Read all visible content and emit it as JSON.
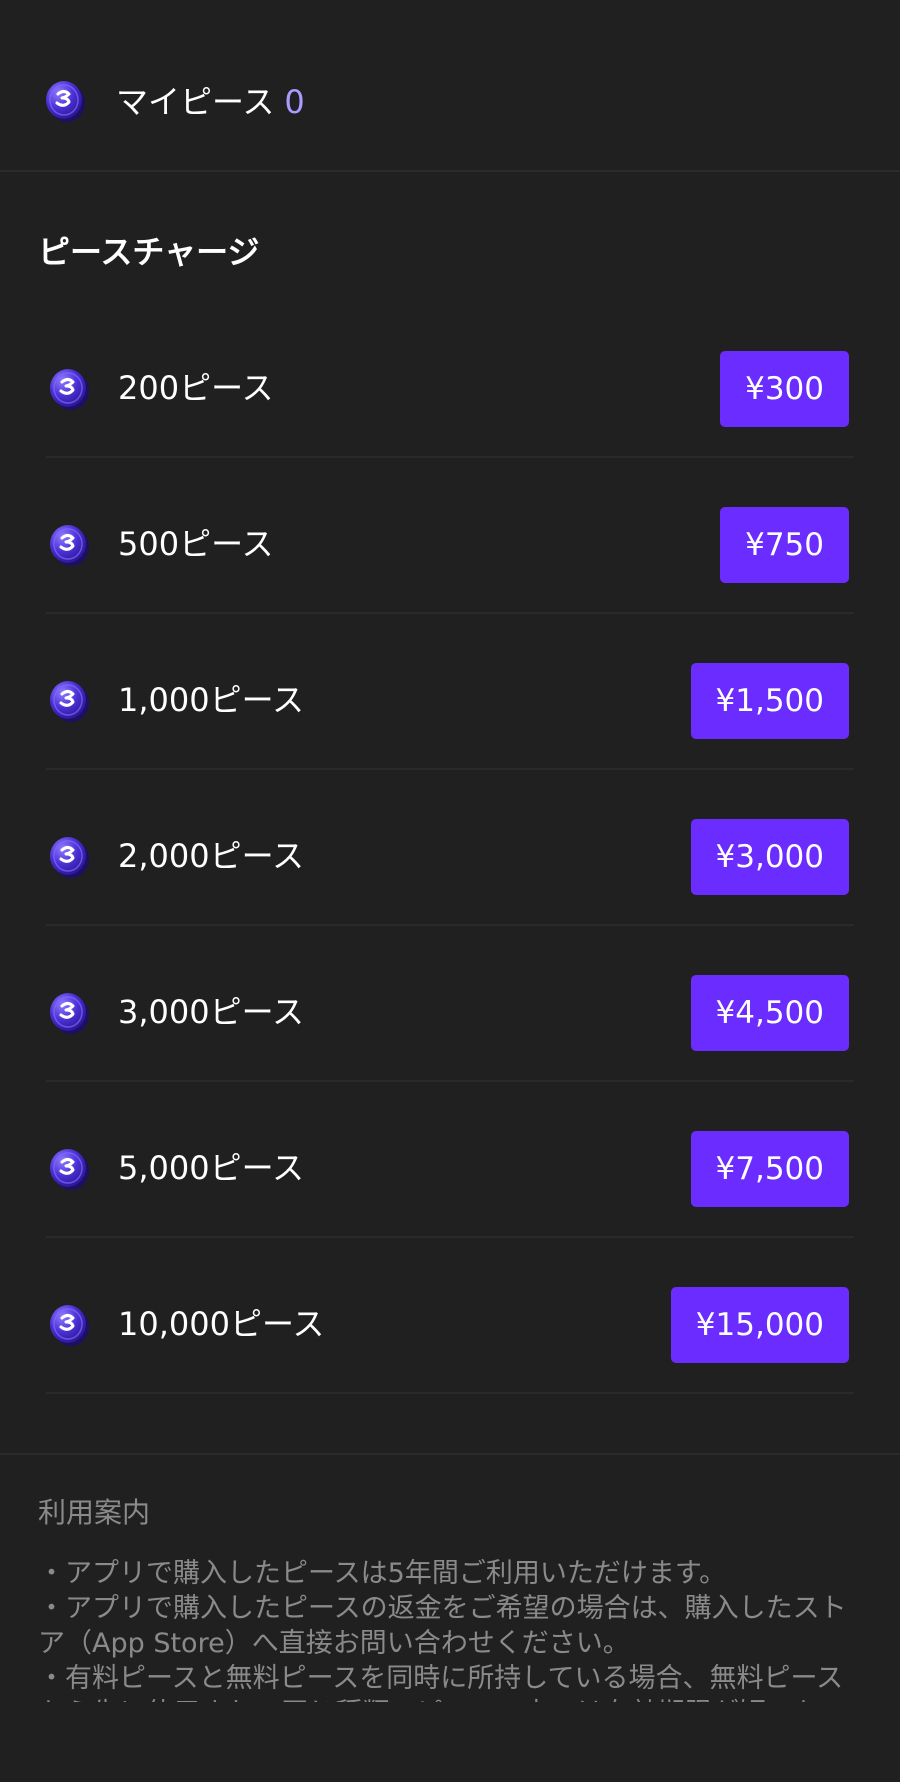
{
  "balance": {
    "label": "マイピース",
    "value": "0"
  },
  "charge": {
    "title": "ピースチャージ",
    "packages": [
      {
        "label": "200ピース",
        "price": "¥300"
      },
      {
        "label": "500ピース",
        "price": "¥750"
      },
      {
        "label": "1,000ピース",
        "price": "¥1,500"
      },
      {
        "label": "2,000ピース",
        "price": "¥3,000"
      },
      {
        "label": "3,000ピース",
        "price": "¥4,500"
      },
      {
        "label": "5,000ピース",
        "price": "¥7,500"
      },
      {
        "label": "10,000ピース",
        "price": "¥15,000"
      }
    ]
  },
  "info": {
    "title": "利用案内",
    "items": [
      "・アプリで購入したピースは5年間ご利用いただけます。",
      "・アプリで購入したピースの返金をご希望の場合は、購入したストア（App Store）へ直接お問い合わせください。",
      "・有料ピースと無料ピースを同時に所持している場合、無料ピースから先に使用され、同じ種類のピースの中では有効期限が短いものから使用されます。"
    ]
  },
  "colors": {
    "background": "#202020",
    "accent": "#6b2cff",
    "balance_value": "#a99bff",
    "muted_text": "#8a8a8a"
  },
  "icons": {
    "coin": "piece-coin-icon"
  }
}
